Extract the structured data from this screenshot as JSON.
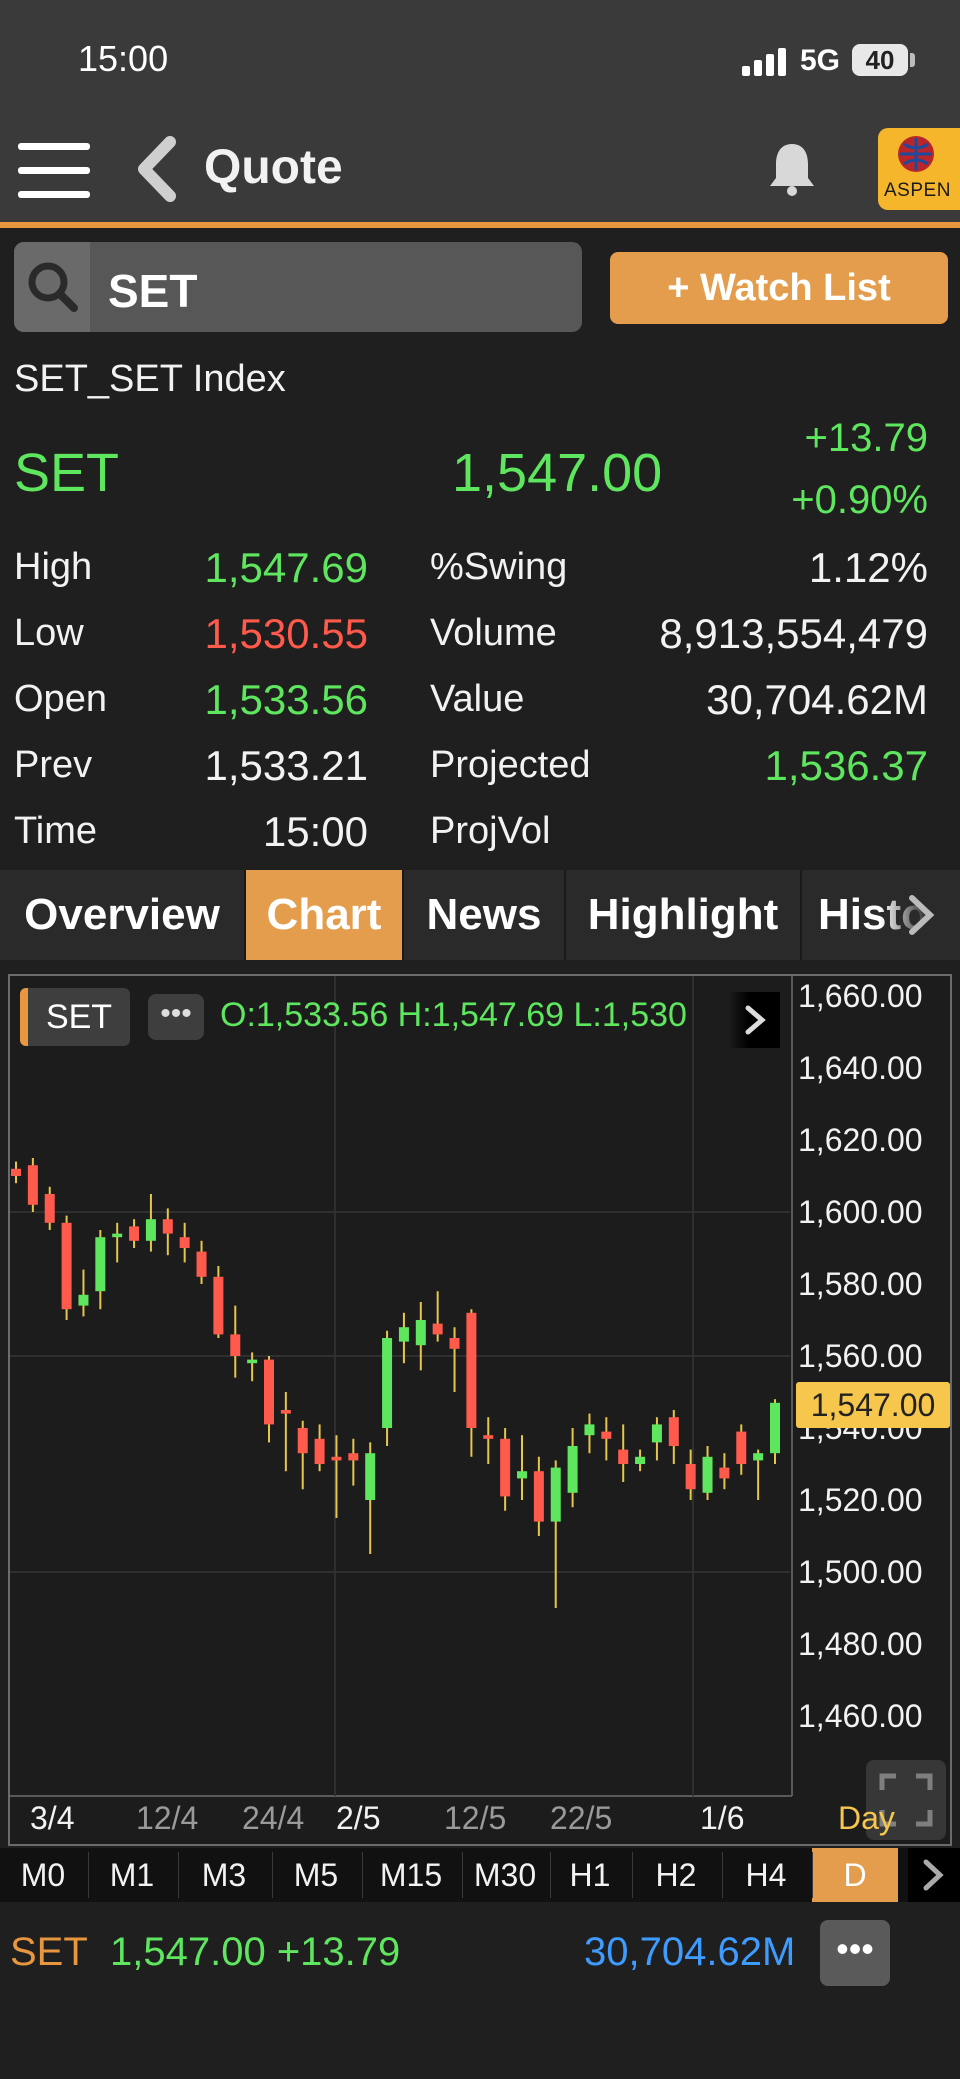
{
  "status_bar": {
    "time": "15:00",
    "network": "5G",
    "battery": "40"
  },
  "header": {
    "title": "Quote",
    "logo_text": "ASPEN"
  },
  "search": {
    "value": "SET"
  },
  "watch_list_label": "+ Watch List",
  "quote": {
    "name": "SET_SET Index",
    "symbol": "SET",
    "last": "1,547.00",
    "change": "+13.79",
    "percent_change": "+0.90%"
  },
  "stats_left": [
    {
      "label": "High",
      "value": "1,547.69",
      "color": "#5fe65f"
    },
    {
      "label": "Low",
      "value": "1,530.55",
      "color": "#ff5a4b"
    },
    {
      "label": "Open",
      "value": "1,533.56",
      "color": "#5fe65f"
    },
    {
      "label": "Prev",
      "value": "1,533.21",
      "color": "#f2f2f2"
    },
    {
      "label": "Time",
      "value": "15:00",
      "color": "#f2f2f2"
    }
  ],
  "stats_right": [
    {
      "label": "%Swing",
      "value": "1.12%",
      "color": "#f2f2f2"
    },
    {
      "label": "Volume",
      "value": "8,913,554,479",
      "color": "#f2f2f2"
    },
    {
      "label": "Value",
      "value": "30,704.62M",
      "color": "#f2f2f2"
    },
    {
      "label": "Projected",
      "value": "1,536.37",
      "color": "#5fe65f"
    },
    {
      "label": "ProjVol",
      "value": "",
      "color": "#f2f2f2"
    }
  ],
  "tabs": [
    "Overview",
    "Chart",
    "News",
    "Highlight",
    "Histor"
  ],
  "active_tab": "Chart",
  "chart": {
    "symbol_badge": "SET",
    "more_label": "•••",
    "ohlc_text": "O:1,533.56  H:1,547.69  L:1,530",
    "current_price": "1,547.00",
    "period_label": "Day",
    "y_tick_labels": [
      "1,660.00",
      "1,640.00",
      "1,620.00",
      "1,600.00",
      "1,580.00",
      "1,560.00",
      "1,540.00",
      "1,520.00",
      "1,500.00",
      "1,480.00",
      "1,460.00"
    ],
    "x_tick_labels": [
      "3/4",
      "12/4",
      "24/4",
      "2/5",
      "12/5",
      "22/5",
      "1/6"
    ]
  },
  "chart_data": {
    "type": "candlestick",
    "y_range": [
      1440,
      1665
    ],
    "y_ticks": [
      1660,
      1640,
      1620,
      1600,
      1580,
      1560,
      1540,
      1520,
      1500,
      1480,
      1460
    ],
    "x_ticks": [
      "3/4",
      "12/4",
      "24/4",
      "2/5",
      "12/5",
      "22/5",
      "1/6"
    ],
    "up_color": "#5fe65f",
    "down_color": "#ff5a4b",
    "candles": [
      [
        1612,
        1614,
        1608,
        1610
      ],
      [
        1613,
        1615,
        1600,
        1602
      ],
      [
        1605,
        1607,
        1595,
        1597
      ],
      [
        1597,
        1599,
        1570,
        1573
      ],
      [
        1574,
        1584,
        1571,
        1577
      ],
      [
        1578,
        1595,
        1573,
        1593
      ],
      [
        1593,
        1597,
        1586,
        1594
      ],
      [
        1596,
        1598,
        1590,
        1592
      ],
      [
        1592,
        1605,
        1589,
        1598
      ],
      [
        1598,
        1601,
        1588,
        1594
      ],
      [
        1593,
        1597,
        1586,
        1590
      ],
      [
        1589,
        1592,
        1580,
        1582
      ],
      [
        1582,
        1585,
        1565,
        1566
      ],
      [
        1566,
        1574,
        1554,
        1560
      ],
      [
        1558,
        1561,
        1553,
        1559
      ],
      [
        1559,
        1560,
        1536,
        1541
      ],
      [
        1545,
        1550,
        1528,
        1544
      ],
      [
        1540,
        1542,
        1523,
        1533
      ],
      [
        1537,
        1541,
        1528,
        1530
      ],
      [
        1532,
        1538,
        1515,
        1531
      ],
      [
        1533,
        1537,
        1524,
        1531
      ],
      [
        1520,
        1536,
        1505,
        1533
      ],
      [
        1540,
        1567,
        1535,
        1565
      ],
      [
        1564,
        1572,
        1558,
        1568
      ],
      [
        1563,
        1575,
        1556,
        1570
      ],
      [
        1569,
        1578,
        1564,
        1566
      ],
      [
        1565,
        1568,
        1550,
        1562
      ],
      [
        1572,
        1573,
        1532,
        1540
      ],
      [
        1538,
        1543,
        1530,
        1537
      ],
      [
        1537,
        1540,
        1517,
        1521
      ],
      [
        1526,
        1538,
        1520,
        1528
      ],
      [
        1528,
        1532,
        1510,
        1514
      ],
      [
        1514,
        1531,
        1490,
        1529
      ],
      [
        1522,
        1540,
        1518,
        1535
      ],
      [
        1538,
        1544,
        1533,
        1541
      ],
      [
        1539,
        1543,
        1531,
        1537
      ],
      [
        1534,
        1541,
        1525,
        1530
      ],
      [
        1530,
        1534,
        1528,
        1532
      ],
      [
        1536,
        1543,
        1531,
        1541
      ],
      [
        1543,
        1545,
        1530,
        1535
      ],
      [
        1530,
        1534,
        1520,
        1523
      ],
      [
        1522,
        1535,
        1520,
        1532
      ],
      [
        1529,
        1533,
        1523,
        1526
      ],
      [
        1539,
        1541,
        1527,
        1530
      ],
      [
        1531,
        1534,
        1520,
        1533
      ],
      [
        1533,
        1548,
        1530,
        1547
      ]
    ]
  },
  "intervals": [
    "M0",
    "M1",
    "M3",
    "M5",
    "M15",
    "M30",
    "H1",
    "H2",
    "H4",
    "D"
  ],
  "active_interval": "D",
  "bottom_bar": {
    "symbol": "SET",
    "last_change": "1,547.00 +13.79",
    "value": "30,704.62M",
    "more_label": "•••"
  }
}
